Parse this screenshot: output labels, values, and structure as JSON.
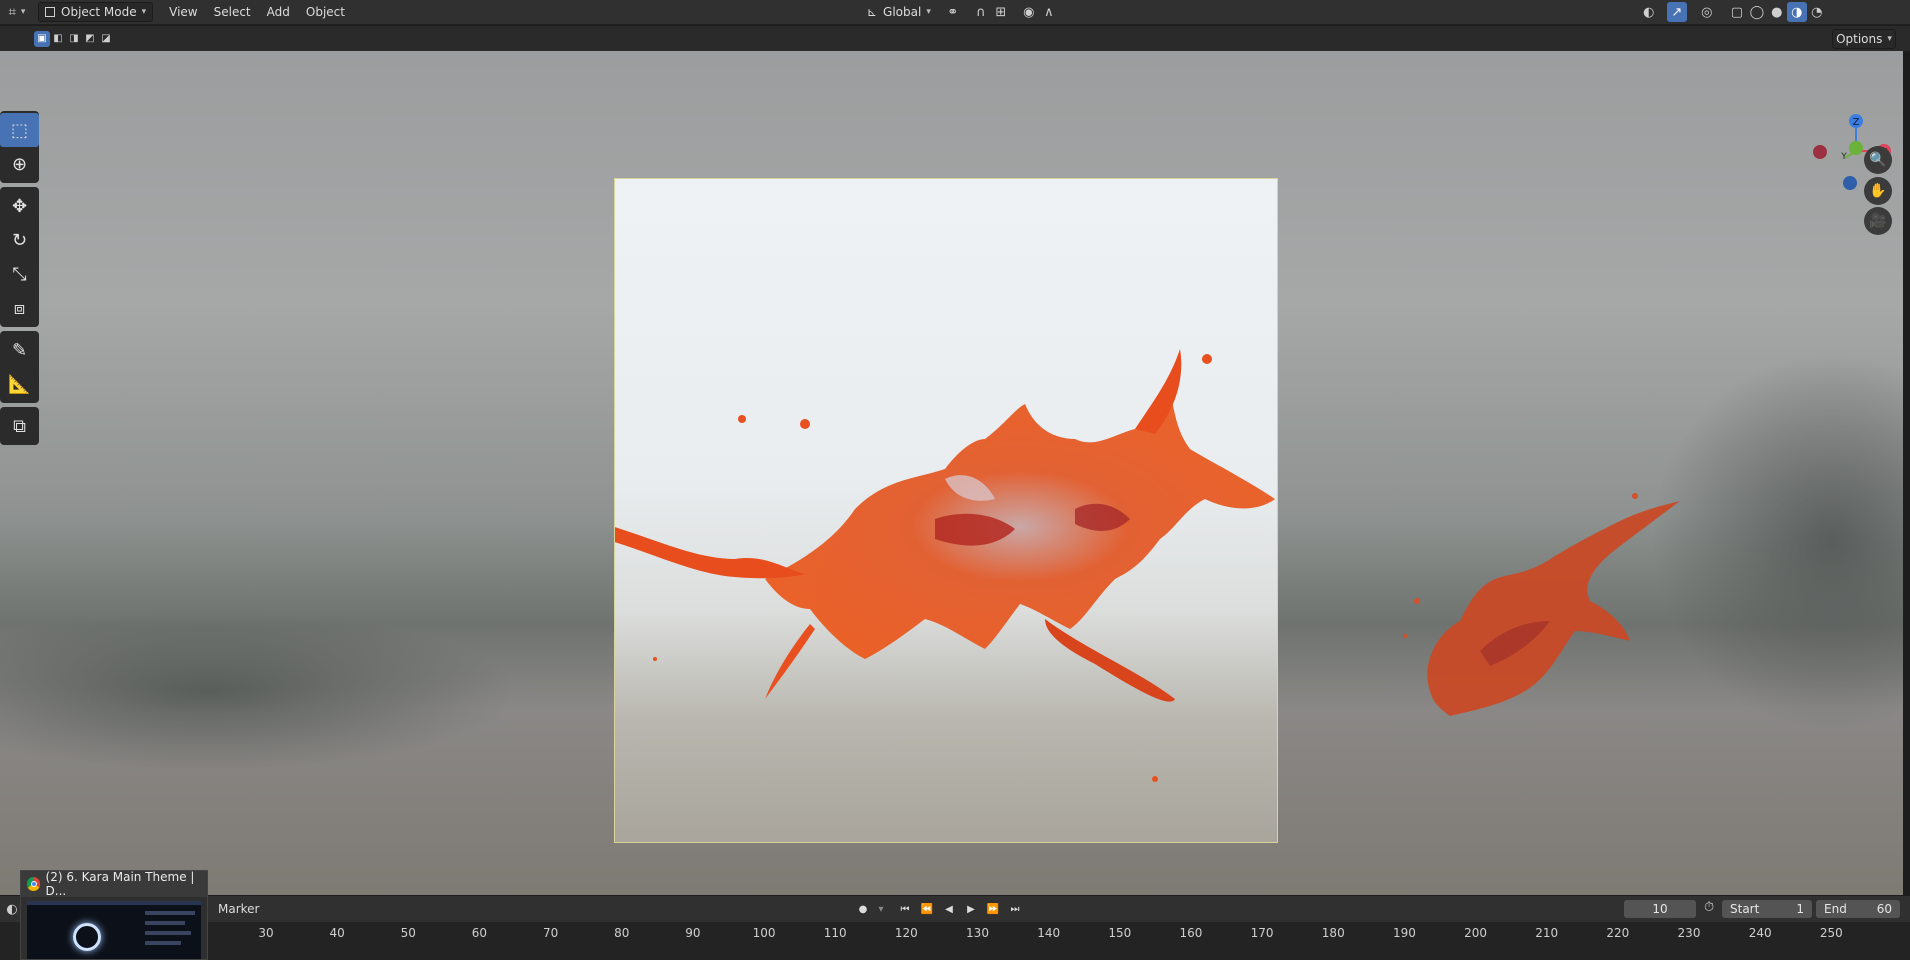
{
  "header": {
    "mode": "Object Mode",
    "menus": [
      "View",
      "Select",
      "Add",
      "Object"
    ],
    "orientation": "Global"
  },
  "viewport": {
    "options_label": "Options",
    "axes": {
      "z": "Z",
      "y": "Y",
      "x": "X"
    }
  },
  "timeline": {
    "marker_label": "Marker",
    "current_frame": "10",
    "start_label": "Start",
    "start_value": "1",
    "end_label": "End",
    "end_value": "60",
    "ticks": [
      "30",
      "40",
      "50",
      "60",
      "70",
      "80",
      "90",
      "100",
      "110",
      "120",
      "130",
      "140",
      "150",
      "160",
      "170",
      "180",
      "190",
      "200",
      "210",
      "220",
      "230",
      "240",
      "250"
    ]
  },
  "taskbar_preview": {
    "title": "(2) 6. Kara Main Theme | D..."
  },
  "colors": {
    "accent": "#4772b3",
    "splash": "#e8501f",
    "splash_dark": "#b42a22"
  }
}
